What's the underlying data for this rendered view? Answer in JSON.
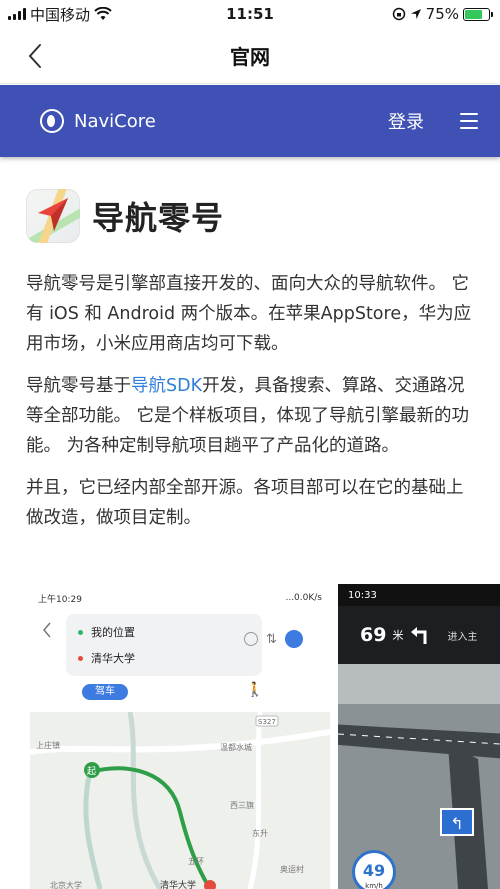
{
  "status_bar": {
    "carrier": "中国移动",
    "time": "11:51",
    "battery_text": "75%",
    "battery_level": 0.75
  },
  "nav_bar": {
    "title": "官网",
    "back_icon": "chevron-left-icon"
  },
  "site_header": {
    "brand": "NaviCore",
    "login": "登录",
    "menu_icon": "hamburger-icon",
    "background_color": "#3f51b5"
  },
  "app": {
    "name": "导航零号"
  },
  "paragraphs": {
    "p1": "导航零号是引擎部直接开发的、面向大众的导航软件。 它有 iOS 和 Android 两个版本。在苹果AppStore，华为应用市场，小米应用商店均可下载。",
    "p2_before": "导航零号基于",
    "p2_link": "导航SDK",
    "p2_after": "开发，具备搜索、算路、交通路况等全部功能。 它是个样板项目，体现了导航引擎最新的功能。 为各种定制导航项目趟平了产品化的道路。",
    "p3": "并且，它已经内部全部开源。各项目部可以在它的基础上做改造，做项目定制。"
  },
  "screenshot_1": {
    "status_time": "上午10:29",
    "status_right": "...0.0K/s",
    "origin": "我的位置",
    "destination": "清华大学",
    "mode_drive": "驾车",
    "map_labels": {
      "start": "起",
      "road": "S327",
      "place1": "上庄镇",
      "place2": "温都水城",
      "place3": "西三旗",
      "place4": "东升",
      "place5": "五环",
      "place6": "清华大学",
      "place7": "北京大学",
      "place8": "奥运村"
    }
  },
  "screenshot_2": {
    "status_time": "10:33",
    "distance": "69",
    "unit": "米",
    "enter": "进入主",
    "speed": "49",
    "speed_unit": "km/h"
  }
}
